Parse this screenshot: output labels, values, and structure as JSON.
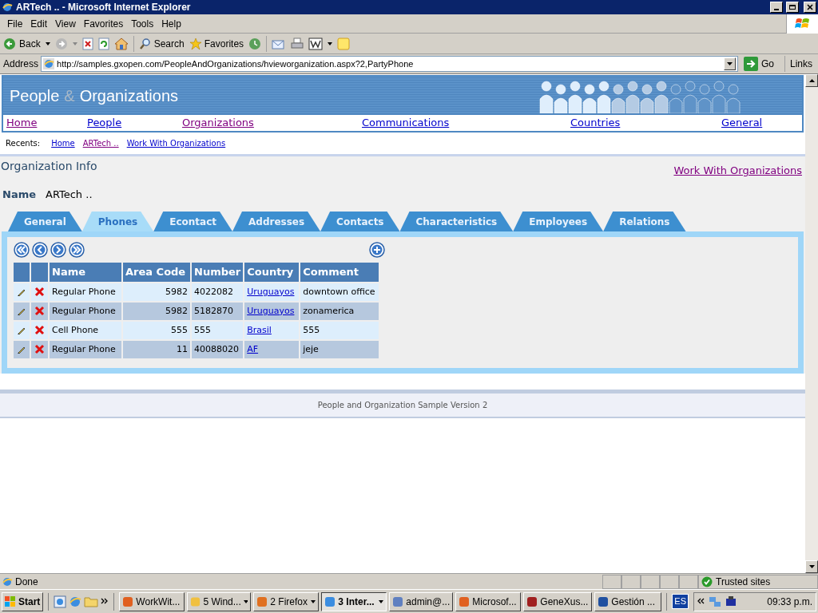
{
  "window": {
    "title": "ARTech .. - Microsoft Internet Explorer"
  },
  "menu_bar": [
    "File",
    "Edit",
    "View",
    "Favorites",
    "Tools",
    "Help"
  ],
  "toolbar": {
    "back": "Back",
    "search": "Search",
    "favorites": "Favorites"
  },
  "address_bar": {
    "label": "Address",
    "value": "http://samples.gxopen.com/PeopleAndOrganizations/hvieworganization.aspx?2,PartyPhone",
    "go": "Go",
    "links": "Links"
  },
  "banner": {
    "title_start": "People",
    "ampersand": "&",
    "title_end": "Organizations"
  },
  "nav": [
    {
      "label": "Home",
      "visited": true
    },
    {
      "label": "People",
      "visited": false
    },
    {
      "label": "Organizations",
      "visited": true
    },
    {
      "label": "Communications",
      "visited": false
    },
    {
      "label": "Countries",
      "visited": false
    },
    {
      "label": "General",
      "visited": false
    }
  ],
  "recents": {
    "label": "Recents:",
    "links": [
      {
        "label": "Home",
        "visited": false
      },
      {
        "label": "ARTech ..",
        "visited": true
      },
      {
        "label": "Work With Organizations",
        "visited": false
      }
    ]
  },
  "section_title": "Organization Info",
  "work_with_link": "Work With Organizations",
  "name_field": {
    "label": "Name",
    "value": "ARTech .."
  },
  "tabs": [
    {
      "label": "General",
      "selected": false
    },
    {
      "label": "Phones",
      "selected": true
    },
    {
      "label": "Econtact",
      "selected": false
    },
    {
      "label": "Addresses",
      "selected": false
    },
    {
      "label": "Contacts",
      "selected": false
    },
    {
      "label": "Characteristics",
      "selected": false
    },
    {
      "label": "Employees",
      "selected": false
    },
    {
      "label": "Relations",
      "selected": false
    }
  ],
  "table": {
    "columns": [
      "Name",
      "Area Code",
      "Number",
      "Country",
      "Comment"
    ],
    "rows": [
      {
        "name": "Regular Phone",
        "area_code": "5982",
        "number": "4022082",
        "country": "Uruguayos",
        "comment": "downtown office"
      },
      {
        "name": "Regular Phone",
        "area_code": "5982",
        "number": "5182870",
        "country": "Uruguayos",
        "comment": "zonamerica"
      },
      {
        "name": "Cell Phone",
        "area_code": "555",
        "number": "555",
        "country": "Brasil",
        "comment": "555"
      },
      {
        "name": "Regular Phone",
        "area_code": "11",
        "number": "40088020",
        "country": "AF",
        "comment": "jeje"
      }
    ]
  },
  "footer": "People and Organization Sample Version 2",
  "status_bar": {
    "text": "Done",
    "zone": "Trusted sites"
  },
  "taskbar": {
    "start": "Start",
    "items": [
      {
        "label": "WorkWit...",
        "dropdown": false,
        "selected": false
      },
      {
        "label": "5 Wind...",
        "dropdown": true,
        "selected": false
      },
      {
        "label": "2 Firefox",
        "dropdown": true,
        "selected": false
      },
      {
        "label": "3 Inter...",
        "dropdown": true,
        "selected": true
      },
      {
        "label": "admin@...",
        "dropdown": false,
        "selected": false
      },
      {
        "label": "Microsof...",
        "dropdown": false,
        "selected": false
      },
      {
        "label": "GeneXus...",
        "dropdown": false,
        "selected": false
      },
      {
        "label": "Gestión ...",
        "dropdown": false,
        "selected": false
      }
    ],
    "language": "ES",
    "clock": "09:33 p.m."
  }
}
